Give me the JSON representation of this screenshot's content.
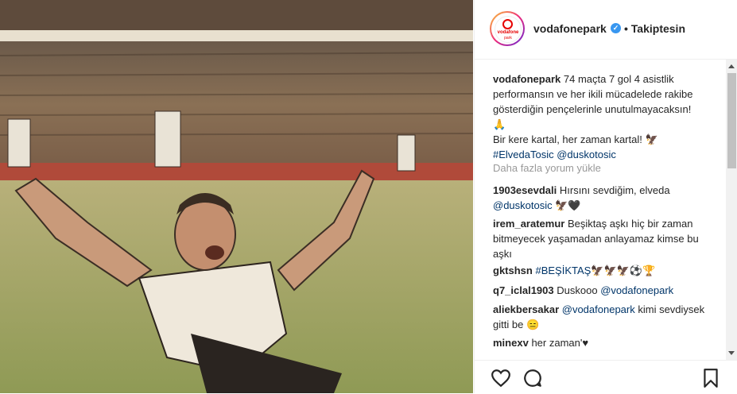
{
  "post": {
    "image_alt": "Footballer celebrating on his knees with arms spread",
    "account": {
      "username": "vodafonepark",
      "follow_status": "• Takiptesin",
      "avatar_text_1": "vodafone",
      "avatar_text_2": "park"
    },
    "caption": {
      "username": "vodafonepark",
      "line1": "74 maçta 7 gol 4 asistlik performansın ve her ikili mücadelede rakibe gösterdiğin pençelerinle unutulmayacaksın!",
      "emoji1": "🙏",
      "line2": "Bir kere kartal, her zaman kartal!",
      "emoji2": "🦅",
      "hashtag": "#ElvedaTosic",
      "mention": "@duskotosic"
    },
    "load_more": "Daha fazla yorum yükle",
    "comments": [
      {
        "user": "1903esevdali",
        "text": "Hırsını sevdiğim, elveda",
        "mention": "@duskotosic",
        "emoji": "🦅🖤"
      },
      {
        "user": "irem_aratemur",
        "text": "Beşiktaş aşkı hiç bir zaman bitmeyecek yaşamadan anlayamaz kimse bu aşkı"
      },
      {
        "user": "gktshsn",
        "hashtag": "#BEŞİKTAŞ",
        "emoji": "🦅🦅🦅⚽🏆"
      },
      {
        "user": "q7_iclal1903",
        "text": "Duskooo",
        "mention": "@vodafonepark"
      },
      {
        "user": "aliekbersakar",
        "mention": "@vodafonepark",
        "text": "kimi sevdiysek gitti be",
        "emoji": "😑"
      },
      {
        "user": "minexv",
        "text": "her zaman'♥"
      }
    ],
    "actions": [
      "heart-icon",
      "comment-icon",
      "bookmark-icon"
    ]
  }
}
